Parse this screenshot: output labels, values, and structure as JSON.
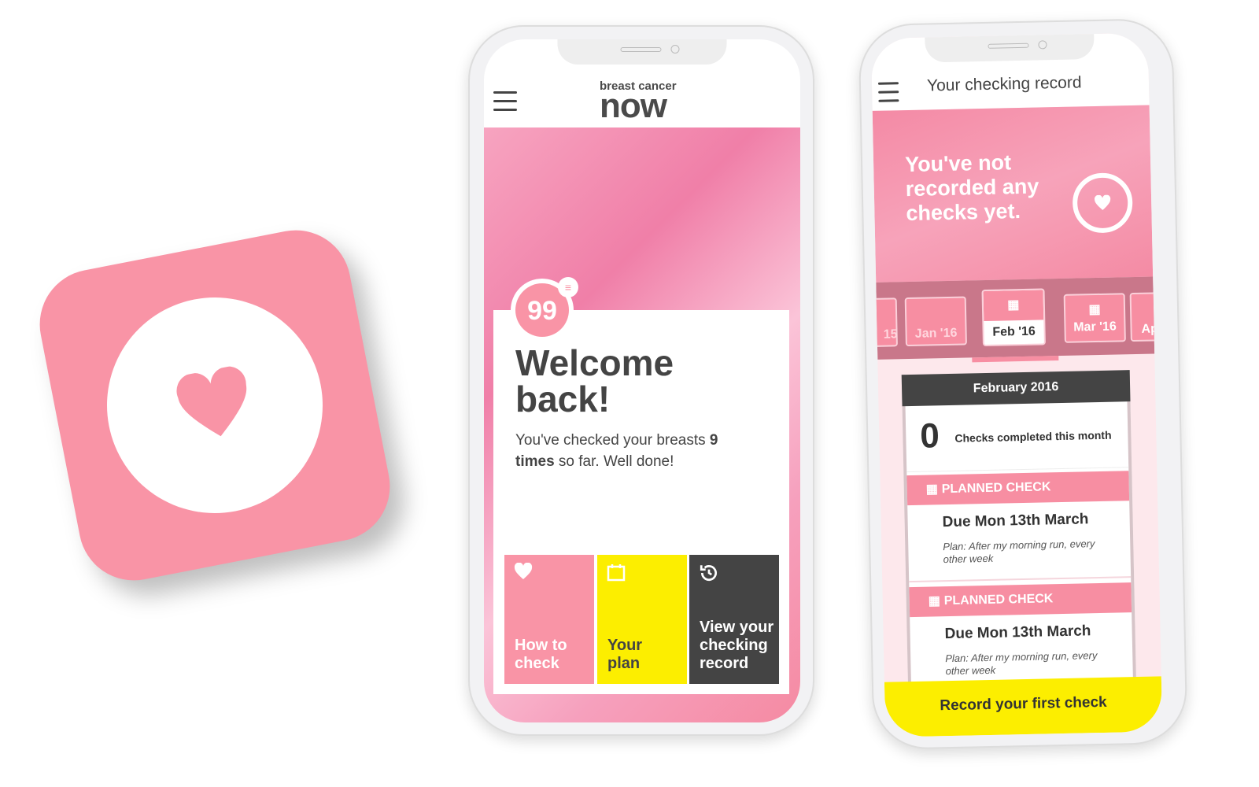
{
  "colors": {
    "pink": "#f994a6",
    "yellow": "#fcee00",
    "dark": "#444444"
  },
  "app_icon": {
    "icon": "heart-icon"
  },
  "home": {
    "logo_top": "breast cancer",
    "logo_bottom": "now",
    "badge": "99",
    "title": "Welcome back!",
    "message_pre": "You've checked your breasts ",
    "count": "9",
    "message_times": "times",
    "message_post": " so far. Well done!",
    "tiles": [
      {
        "label": "How to check",
        "icon": "heart-icon"
      },
      {
        "label": "Your plan",
        "icon": "calendar-icon"
      },
      {
        "label": "View your checking record",
        "icon": "history-icon"
      }
    ]
  },
  "record": {
    "title": "Your checking record",
    "banner": "You've not recorded any checks yet.",
    "months": [
      "15",
      "Jan '16",
      "Feb '16",
      "Mar '16",
      "Ap"
    ],
    "selected_month": "February 2016",
    "checks_count": "0",
    "checks_label": "Checks completed this month",
    "planned": [
      {
        "label": "PLANNED CHECK",
        "due": "Due Mon 13th March",
        "plan": "Plan: After my morning run, every other week"
      },
      {
        "label": "PLANNED CHECK",
        "due": "Due Mon 13th March",
        "plan": "Plan: After my morning run, every other week"
      }
    ],
    "cta": "Record your first check"
  }
}
